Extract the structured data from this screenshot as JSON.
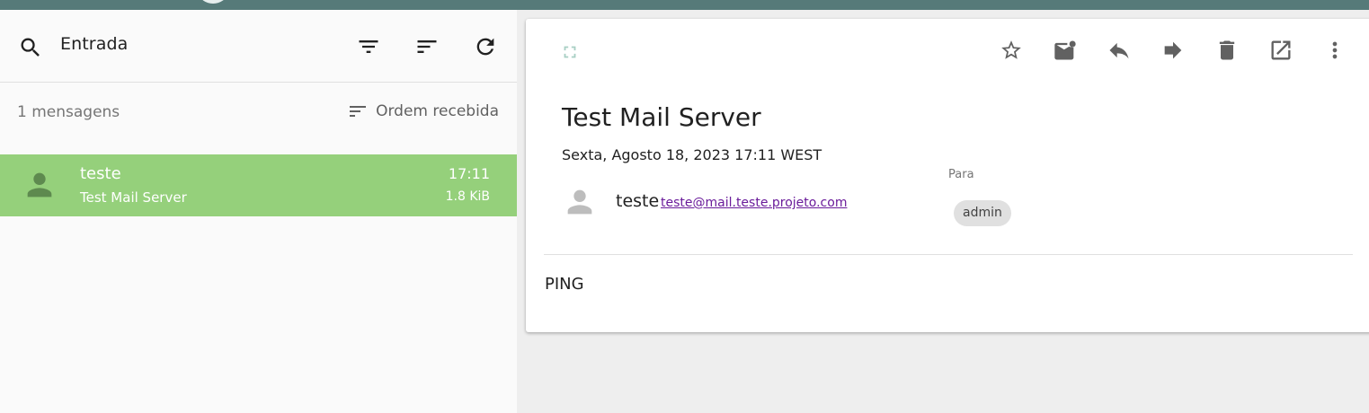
{
  "colors": {
    "topbar": "#567a79",
    "selected_row": "#95d07b",
    "icon_gray": "#616161"
  },
  "left_pane": {
    "folder_name": "Entrada",
    "message_count": "1 mensagens",
    "sort_label": "Ordem recebida",
    "icons": [
      "search-icon",
      "filter-icon",
      "sort-icon",
      "refresh-icon",
      "sort-lines-icon"
    ],
    "messages": [
      {
        "from": "teste",
        "subject": "Test Mail Server",
        "time": "17:11",
        "size": "1.8 KiB"
      }
    ]
  },
  "message_view": {
    "subject": "Test Mail Server",
    "date": "Sexta, Agosto 18, 2023 17:11 WEST",
    "sender_name": "teste",
    "sender_email": "teste@mail.teste.projeto.com",
    "to_label": "Para",
    "to_recipient": "admin",
    "body": "PING",
    "toolbar_icons": [
      "star-icon",
      "mark-unread-icon",
      "reply-icon",
      "forward-icon",
      "delete-icon",
      "open-in-new-icon",
      "more-vert-icon"
    ]
  }
}
